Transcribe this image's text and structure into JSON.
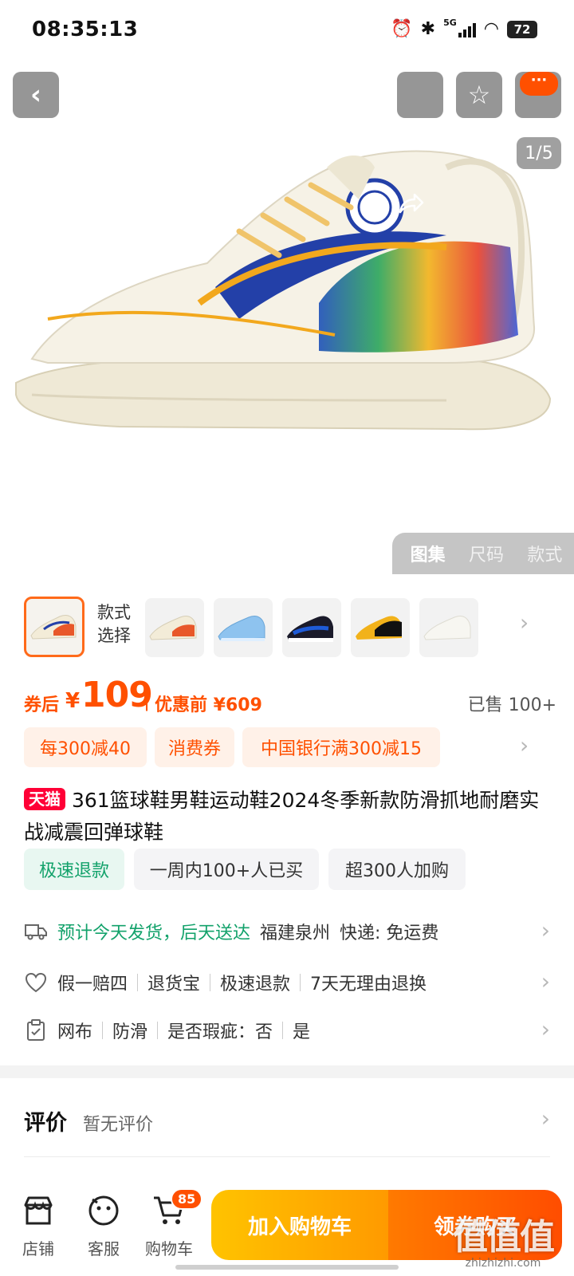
{
  "status_bar": {
    "time": "08:35:13",
    "network": "5G",
    "battery": "72"
  },
  "gallery": {
    "page_indicator": "1/5",
    "more_badge": "···",
    "tabs": [
      "图集",
      "尺码",
      "款式"
    ],
    "active_tab": "图集"
  },
  "style_selector": {
    "label": "款式选择",
    "thumbnails": [
      {
        "colorway": "cream-rainbow"
      },
      {
        "colorway": "light-blue"
      },
      {
        "colorway": "black-blue-white"
      },
      {
        "colorway": "black-yellow"
      },
      {
        "colorway": "all-white"
      }
    ]
  },
  "price": {
    "prefix": "券后",
    "currency": "¥",
    "value": "109",
    "separator": "|",
    "original_label": "优惠前 ¥609",
    "sold": "已售 100+"
  },
  "promotions": [
    "每300减40",
    "消费券",
    "中国银行满300减15"
  ],
  "product": {
    "platform_badge": "天猫",
    "title": "361篮球鞋男鞋运动鞋2024冬季新款防滑抓地耐磨实战减震回弹球鞋"
  },
  "tags": [
    "极速退款",
    "一周内100+人已买",
    "超300人加购"
  ],
  "shipping": {
    "icon": "truck-icon",
    "estimate": "预计今天发货，后天送达",
    "origin": "福建泉州",
    "courier": "快递: 免运费"
  },
  "guarantees": {
    "icon": "heart-shield-icon",
    "items": [
      "假一赔四",
      "退货宝",
      "极速退款",
      "7天无理由退换"
    ]
  },
  "attributes": {
    "icon": "clipboard-icon",
    "items": [
      "网布",
      "防滑",
      "是否瑕疵：否",
      "是"
    ]
  },
  "review": {
    "title": "评价",
    "status": "暂无评价"
  },
  "bottom_bar": {
    "store": "店铺",
    "service": "客服",
    "cart": "购物车",
    "cart_count": "85",
    "add_to_cart": "加入购物车",
    "buy": "领券购买"
  },
  "watermark": {
    "logo": "值值值",
    "url": "zhizhizhi.com"
  },
  "colors": {
    "accent": "#ff5000",
    "tmall": "#ff0036",
    "green": "#13a26b"
  }
}
